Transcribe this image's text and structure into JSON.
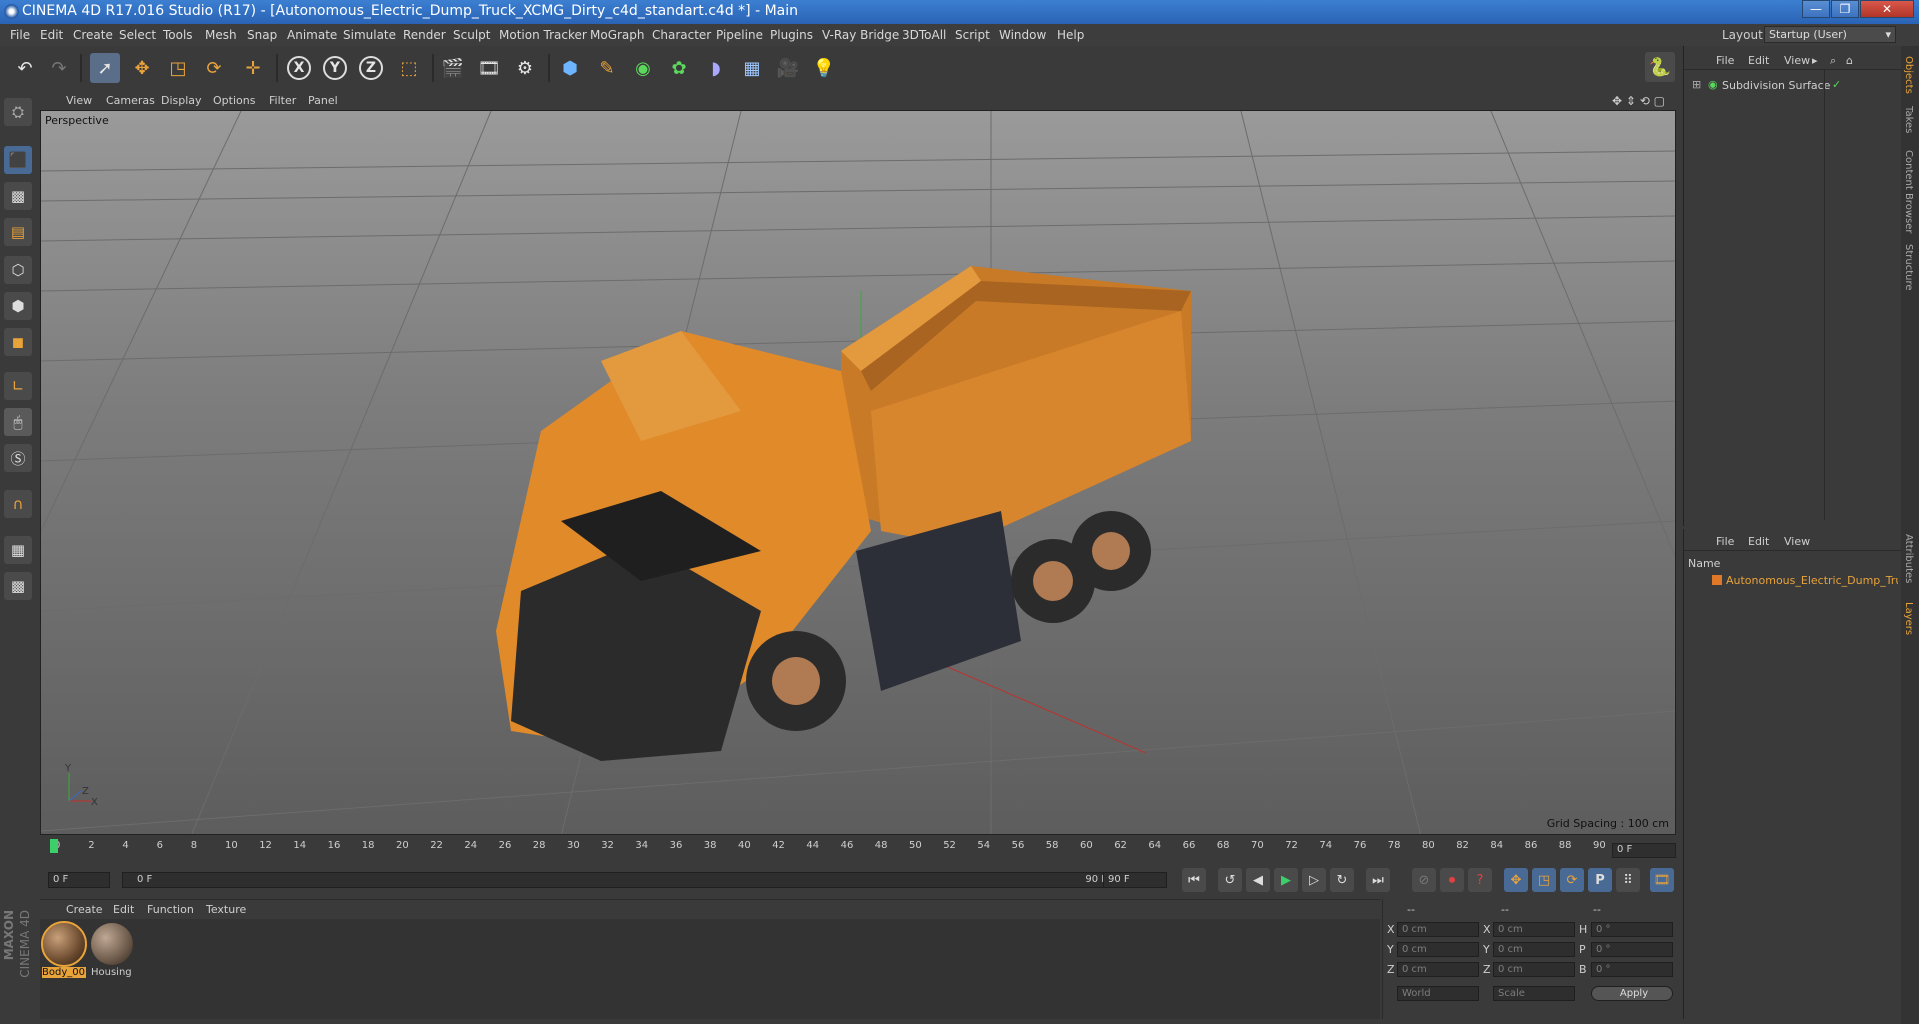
{
  "window": {
    "title": "CINEMA 4D R17.016 Studio (R17) - [Autonomous_Electric_Dump_Truck_XCMG_Dirty_c4d_standart.c4d *] - Main",
    "controls": [
      "—",
      "❐",
      "✕"
    ]
  },
  "menubar": {
    "items": [
      "File",
      "Edit",
      "Create",
      "Select",
      "Tools",
      "Mesh",
      "Snap",
      "Animate",
      "Simulate",
      "Render",
      "Sculpt",
      "Motion Tracker",
      "MoGraph",
      "Character",
      "Pipeline",
      "Plugins",
      "V-Ray Bridge",
      "3DToAll",
      "Script",
      "Window",
      "Help"
    ],
    "layout_label": "Layout:",
    "layout_value": "Startup (User)"
  },
  "toolbar": {
    "icons": [
      "undo-icon",
      "redo-icon",
      "select-icon",
      "move-icon",
      "scale-icon",
      "rotate-icon",
      "transform-icon",
      "x-axis-icon",
      "y-axis-icon",
      "z-axis-icon",
      "coordinate-system-icon",
      "render-view-icon",
      "render-picture-viewer-icon",
      "render-settings-icon",
      "cube-icon",
      "pen-icon",
      "subdivision-icon",
      "cloner-icon",
      "deformer-icon",
      "floor-icon",
      "camera-icon",
      "light-icon",
      "python-icon"
    ],
    "axis_x": "X",
    "axis_y": "Y",
    "axis_z": "Z"
  },
  "viewport": {
    "menu": [
      "View",
      "Cameras",
      "Display",
      "Options",
      "Filter",
      "Panel"
    ],
    "camera_label": "Perspective",
    "grid_spacing": "Grid Spacing : 100 cm",
    "axis_labels": [
      "Y",
      "X",
      "Z"
    ]
  },
  "timeline": {
    "ticks": [
      "0",
      "2",
      "4",
      "6",
      "8",
      "10",
      "12",
      "14",
      "16",
      "18",
      "20",
      "22",
      "24",
      "26",
      "28",
      "30",
      "32",
      "34",
      "36",
      "38",
      "40",
      "42",
      "44",
      "46",
      "48",
      "50",
      "52",
      "54",
      "56",
      "58",
      "60",
      "62",
      "64",
      "66",
      "68",
      "70",
      "72",
      "74",
      "76",
      "78",
      "80",
      "82",
      "84",
      "86",
      "88",
      "90"
    ],
    "current_frame": "0 F",
    "start_field": "0 F",
    "range_start": "0 F",
    "range_end": "90 F",
    "end_field": "90 F"
  },
  "materials": {
    "menu": [
      "Create",
      "Edit",
      "Function",
      "Texture"
    ],
    "items": [
      {
        "name": "Body_00"
      },
      {
        "name": "Housing"
      }
    ]
  },
  "coordinates": {
    "headers": [
      "--",
      "--",
      "--"
    ],
    "rows": [
      {
        "a": "X",
        "av": "0 cm",
        "b": "X",
        "bv": "0 cm",
        "c": "H",
        "cv": "0 °"
      },
      {
        "a": "Y",
        "av": "0 cm",
        "b": "Y",
        "bv": "0 cm",
        "c": "P",
        "cv": "0 °"
      },
      {
        "a": "Z",
        "av": "0 cm",
        "b": "Z",
        "bv": "0 cm",
        "c": "B",
        "cv": "0 °"
      }
    ],
    "mode": "World",
    "transform": "Scale",
    "apply": "Apply"
  },
  "objects": {
    "menu": [
      "File",
      "Edit",
      "View"
    ],
    "items": [
      {
        "name": "Subdivision Surface"
      }
    ]
  },
  "layers": {
    "menu": [
      "File",
      "Edit",
      "View"
    ],
    "header": "Name",
    "items": [
      {
        "name": "Autonomous_Electric_Dump_Truck"
      }
    ]
  },
  "sidetabs": [
    "Objects",
    "Takes",
    "Content Browser",
    "Structure",
    "Attributes",
    "Layers"
  ],
  "brand": {
    "line1": "MAXON",
    "line2": "CINEMA 4D"
  },
  "colors": {
    "accent": "#e8a33a",
    "selection": "#4a6a96",
    "truck_orange": "#e0872a"
  }
}
